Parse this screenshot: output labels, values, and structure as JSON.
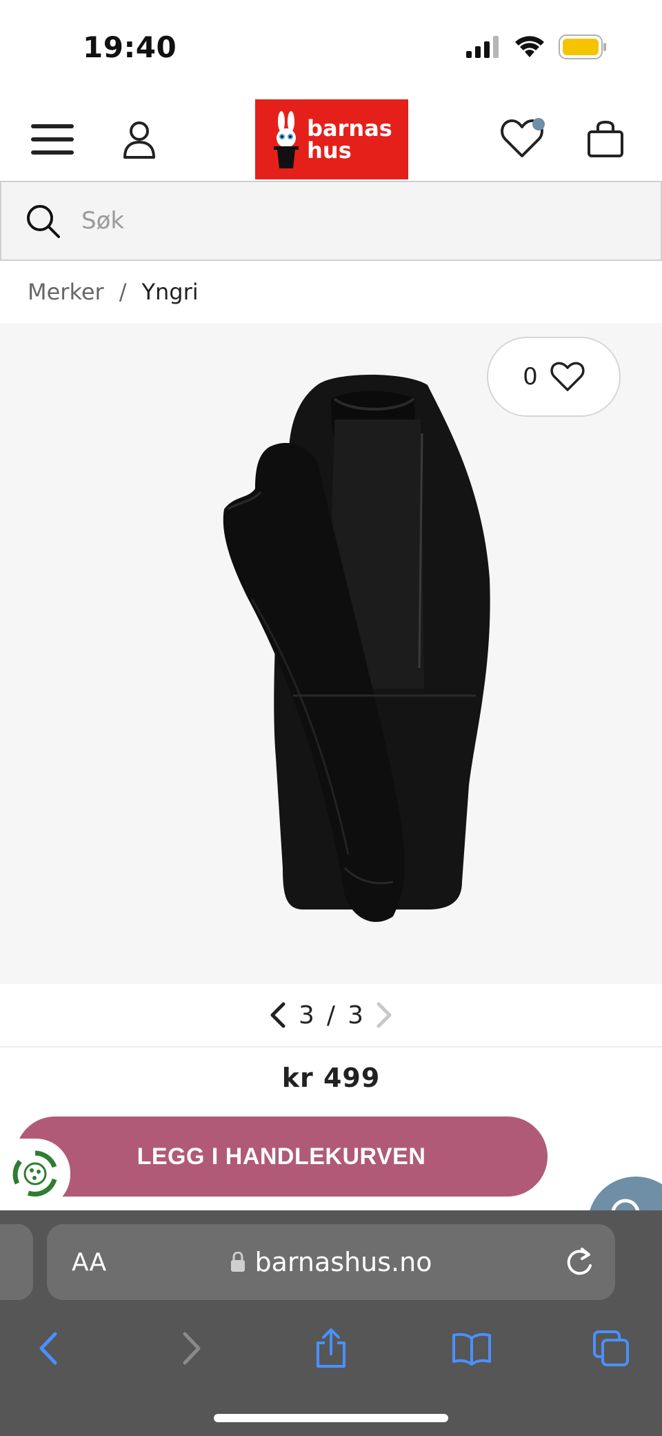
{
  "status_bar": {
    "time": "19:40"
  },
  "header": {
    "logo_line1": "barnas",
    "logo_line2": "hus",
    "wishlist_has_items": true
  },
  "search": {
    "placeholder": "Søk",
    "value": ""
  },
  "breadcrumb": {
    "items": [
      "Merker",
      "Yngri"
    ],
    "separator": "/"
  },
  "product": {
    "favorite_count": "0",
    "image_index": "3",
    "image_total": "3",
    "pager_separator": "/",
    "price": "kr 499",
    "add_to_cart_label": "LEGG I HANDLEKURVEN"
  },
  "browser": {
    "text_size_label": "AA",
    "url": "barnashus.no"
  },
  "colors": {
    "brand_red": "#e5201b",
    "cart_button": "#b05a78",
    "browser_chrome": "#565656",
    "toolbar_blue": "#4a90ff"
  }
}
